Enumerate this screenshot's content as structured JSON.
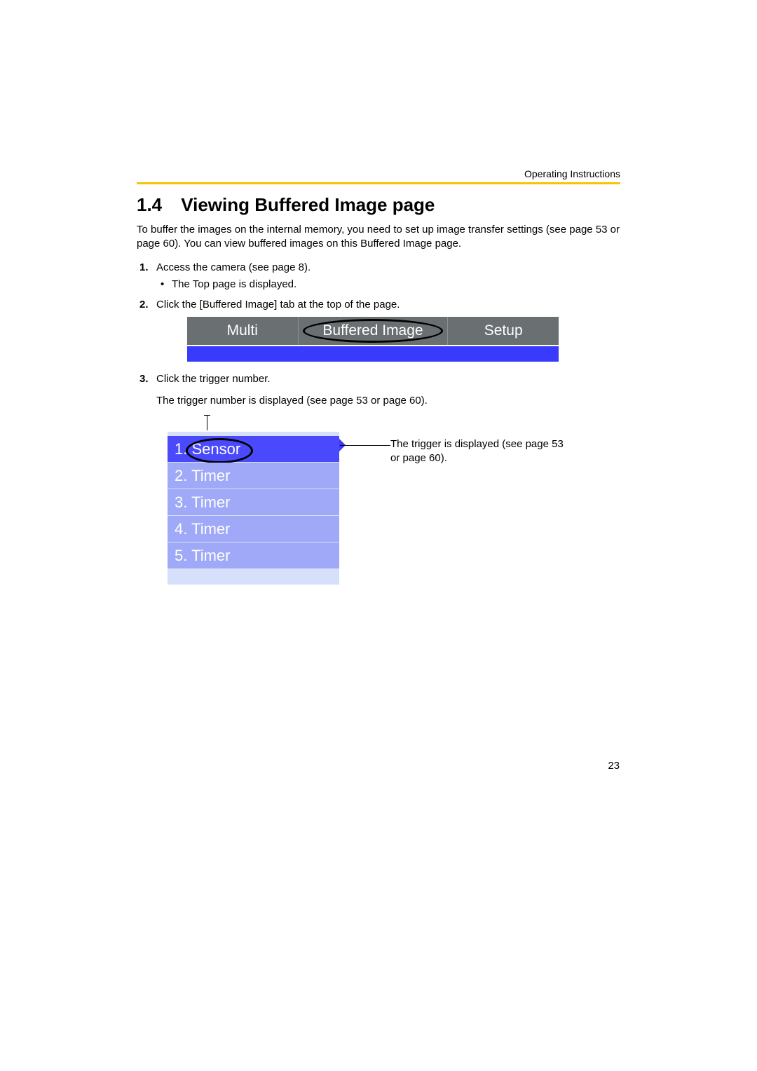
{
  "header": {
    "running_head": "Operating Instructions"
  },
  "section": {
    "number": "1.4",
    "title": "Viewing Buffered Image page",
    "intro": "To buffer the images on the internal memory, you need to set up image transfer settings (see page 53 or page 60). You can view buffered images on this Buffered Image page."
  },
  "steps": [
    {
      "text": "Access the camera (see page 8).",
      "sub": [
        "The Top page is displayed."
      ]
    },
    {
      "text": "Click the [Buffered Image] tab at the top of the page."
    },
    {
      "text": "Click the trigger number."
    }
  ],
  "after_step3": "The trigger number is displayed (see page 53 or page 60).",
  "tabs": {
    "left": "Multi",
    "middle": "Buffered Image",
    "right": "Setup"
  },
  "trigger_list": {
    "items": [
      {
        "n": "1.",
        "label": "Sensor",
        "selected": true
      },
      {
        "n": "2.",
        "label": "Timer"
      },
      {
        "n": "3.",
        "label": "Timer"
      },
      {
        "n": "4.",
        "label": "Timer"
      },
      {
        "n": "5.",
        "label": "Timer"
      }
    ],
    "callout": "The trigger is displayed (see page 53 or page 60)."
  },
  "page_number": "23"
}
